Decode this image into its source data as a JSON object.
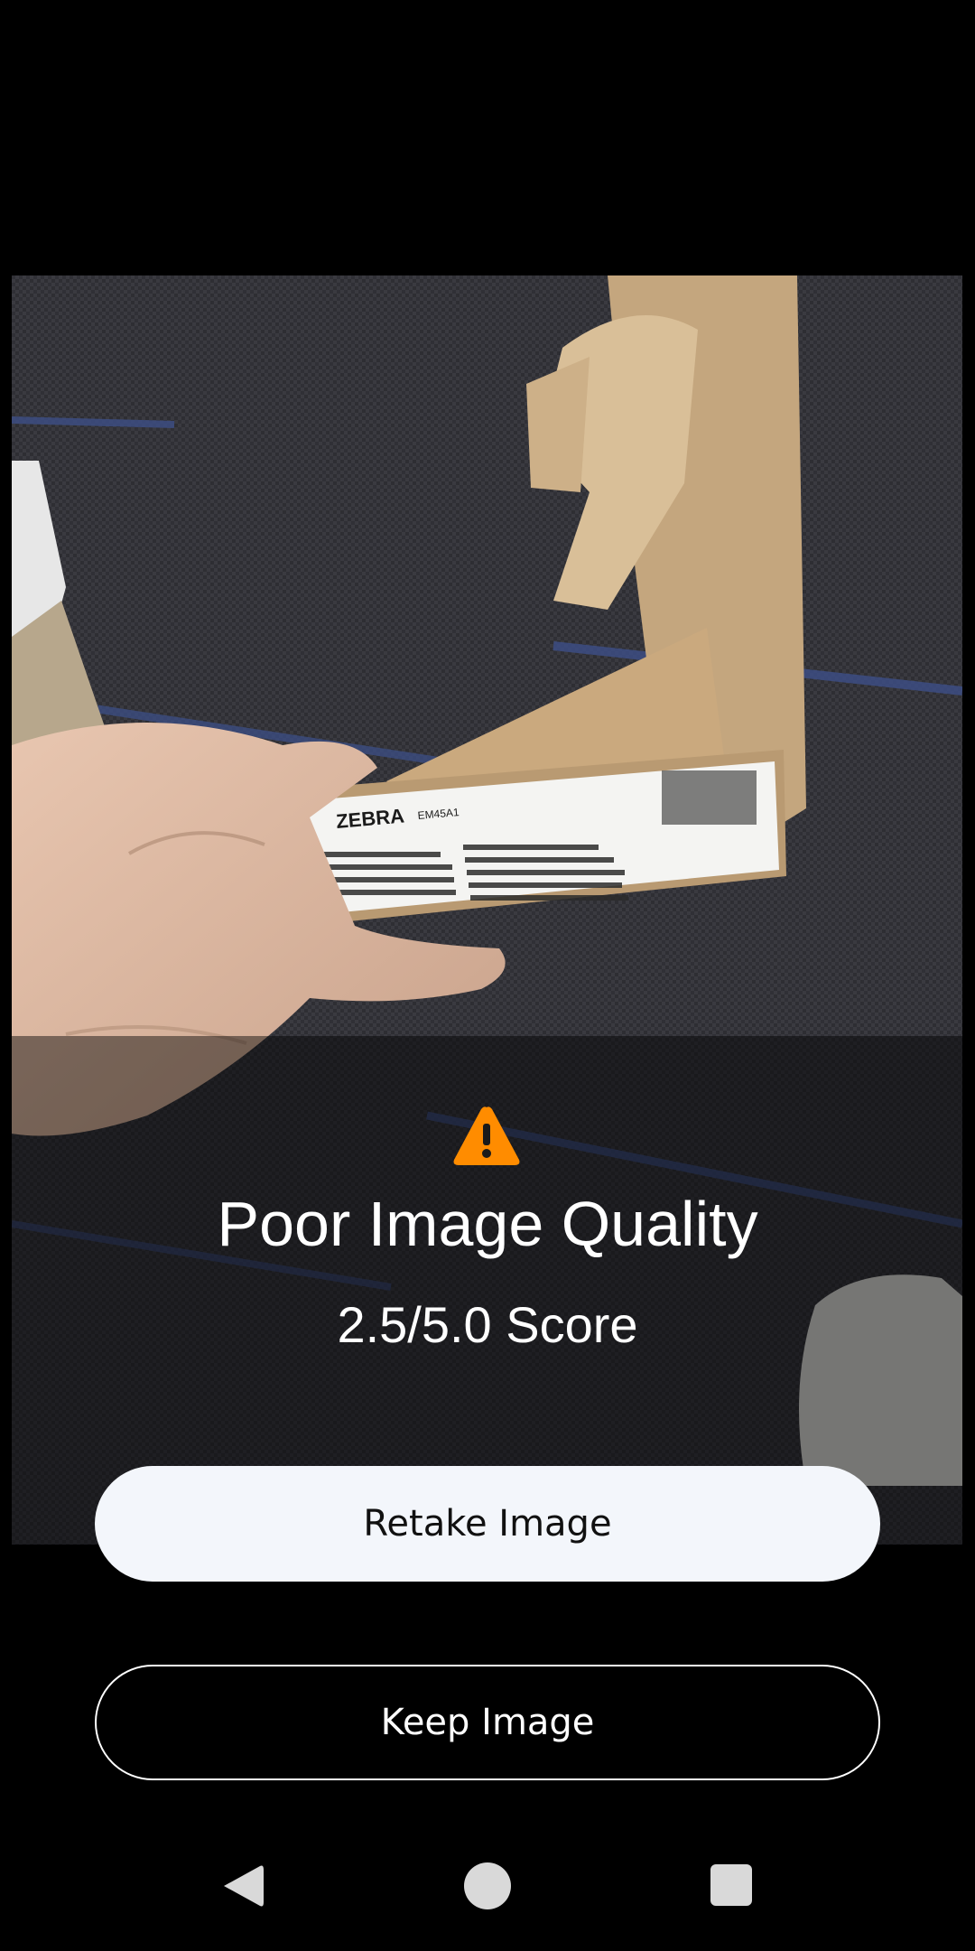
{
  "preview": {
    "label_brand": "ZEBRA",
    "label_model": "EM45A1"
  },
  "result": {
    "icon": "warning-triangle-icon",
    "title": "Poor Image Quality",
    "score": "2.5/5.0 Score"
  },
  "actions": {
    "retake_label": "Retake Image",
    "keep_label": "Keep Image"
  },
  "navigation": {
    "back_icon": "back-triangle-icon",
    "home_icon": "home-circle-icon",
    "recents_icon": "recents-square-icon"
  },
  "colors": {
    "background": "#000000",
    "warning": "#ff8c00",
    "retake_button": "#f3f6fb",
    "text_light": "#ffffff"
  }
}
